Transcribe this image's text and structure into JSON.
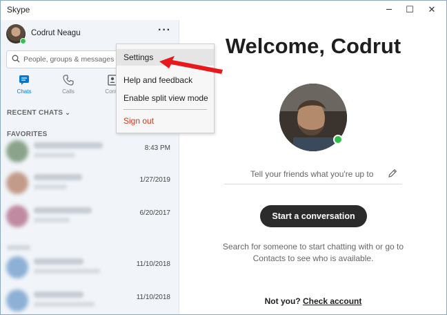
{
  "window": {
    "title": "Skype",
    "min_glyph": "─",
    "max_glyph": "☐",
    "close_glyph": "✕"
  },
  "sidebar": {
    "profile_name": "Codrut Neagu",
    "more_glyph": "···",
    "search_placeholder": "People, groups & messages",
    "tabs": [
      {
        "label": "Chats",
        "icon": "chat-icon",
        "active": true
      },
      {
        "label": "Calls",
        "icon": "phone-icon",
        "active": false
      },
      {
        "label": "Conta",
        "icon": "contacts-icon",
        "active": false
      }
    ],
    "recent_label": "RECENT CHATS",
    "recent_chevron": "⌄",
    "favorites_label": "FAVORITES",
    "chats": [
      {
        "date": "8:43 PM"
      },
      {
        "date": "1/27/2019"
      },
      {
        "date": "6/20/2017"
      },
      {
        "date": "11/10/2018"
      },
      {
        "date": "11/10/2018"
      }
    ]
  },
  "menu": {
    "items": [
      "Settings",
      "Help and feedback",
      "Enable split view mode",
      "Sign out"
    ]
  },
  "main": {
    "welcome": "Welcome, Codrut",
    "mood_placeholder": "Tell your friends what you're up to",
    "start_button": "Start a conversation",
    "hint": "Search for someone to start chatting with or go to Contacts to see who is available.",
    "not_you": "Not you?",
    "check_account": "Check account"
  },
  "colors": {
    "accent": "#0078d4",
    "presence": "#33c050",
    "sign_out": "#d2371e",
    "annotation_arrow": "#e8191c"
  }
}
